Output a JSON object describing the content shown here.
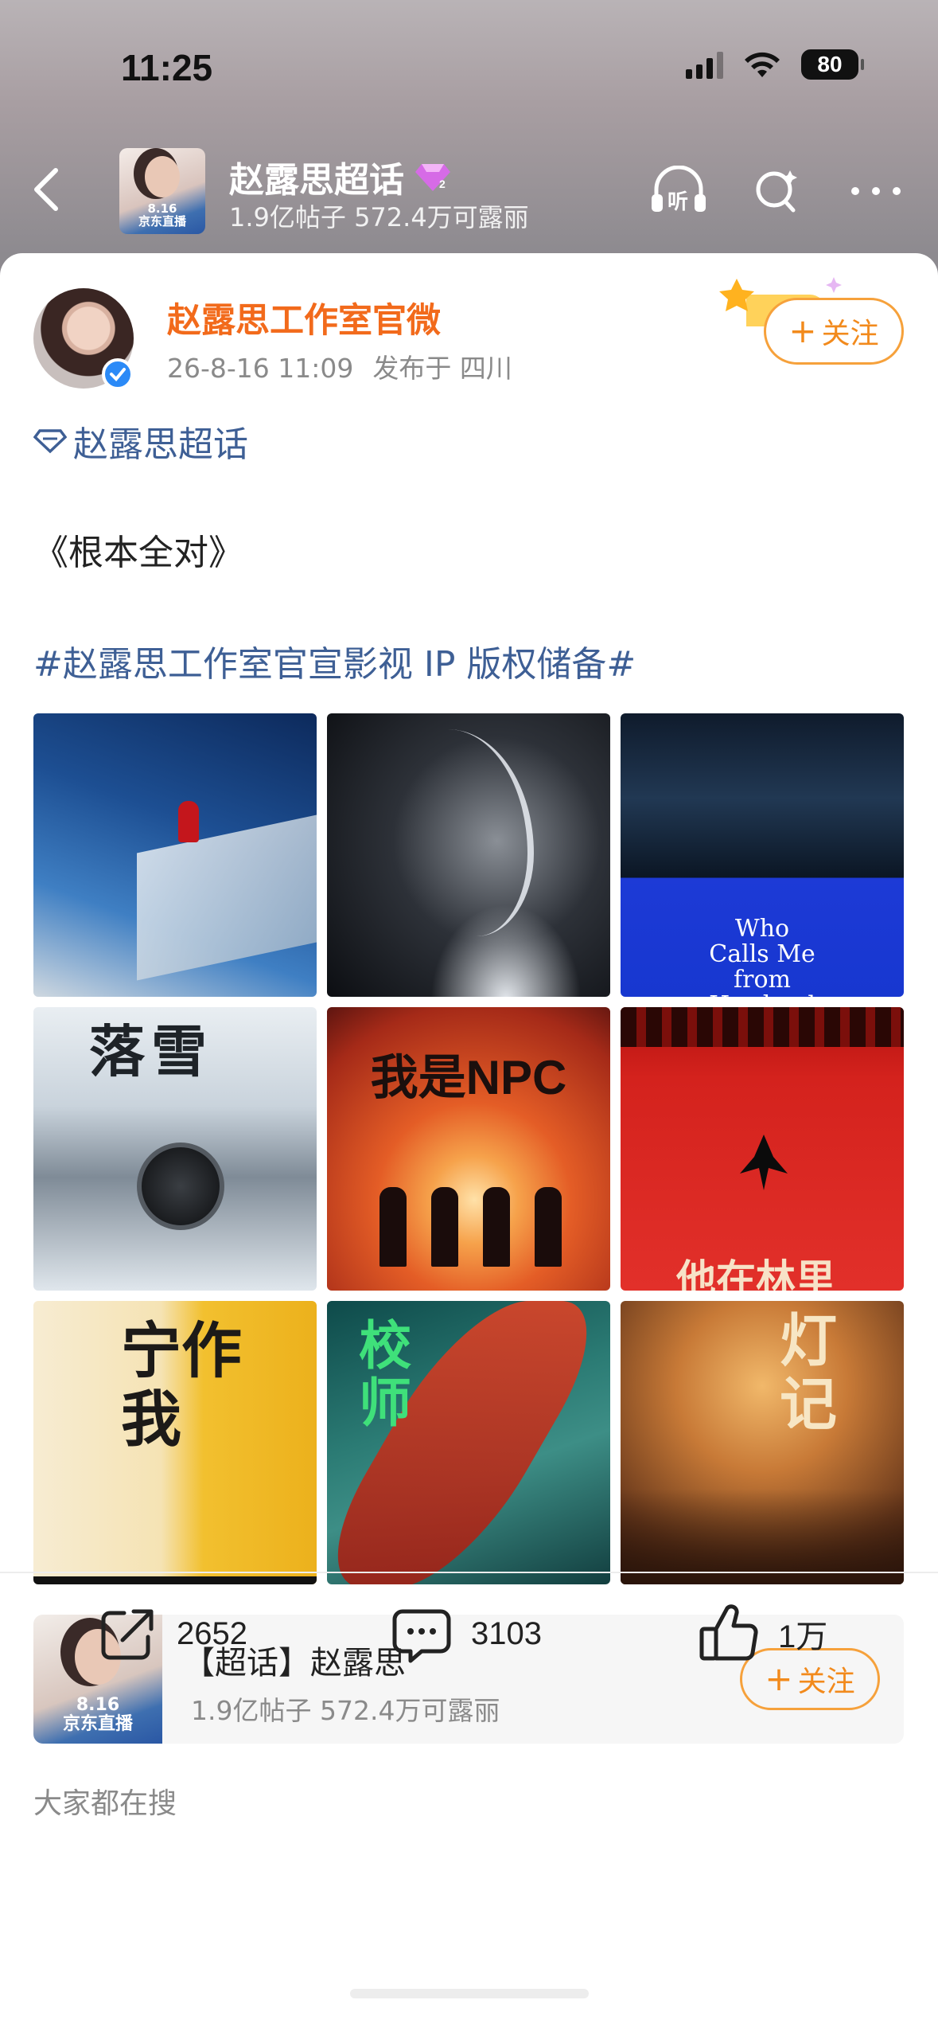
{
  "status_bar": {
    "time": "11:25",
    "battery": "80"
  },
  "header": {
    "avatar_tag": "8.16\n京东直播",
    "title": "赵露思超话",
    "stats": "1.9亿帖子 572.4万可露丽",
    "icons": [
      "back-icon",
      "listen-icon",
      "search-icon",
      "more-icon"
    ],
    "listen_label": "听"
  },
  "post": {
    "author": "赵露思工作室官微",
    "time": "26-8-16 11:09",
    "location": "发布于 四川",
    "follow_label": "关注",
    "topic": "赵露思超话",
    "text": "《根本全对》",
    "hashtag": "#赵露思工作室官宣影视 IP 版权储备#",
    "images": [
      {
        "caption": ""
      },
      {
        "caption": ""
      },
      {
        "caption": "Who\nCalls Me\nfrom\nHer land"
      },
      {
        "caption": "落雪"
      },
      {
        "caption": "我是NPC"
      },
      {
        "caption": "他在林里"
      },
      {
        "caption": "宁作\n我"
      },
      {
        "caption": "校\n师"
      },
      {
        "caption": "灯\n记"
      }
    ]
  },
  "topic_card": {
    "thumb_tag": "8.16\n京东直播",
    "title": "【超话】赵露思",
    "stats": "1.9亿帖子 572.4万可露丽",
    "follow_label": "关注"
  },
  "search_label": "大家都在搜",
  "actions": {
    "share_count": "2652",
    "comment_count": "3103",
    "like_count": "1万"
  },
  "colors": {
    "accent_orange": "#f26a1b",
    "link_blue": "#3e5f95",
    "follow_border": "#f6a13b"
  }
}
